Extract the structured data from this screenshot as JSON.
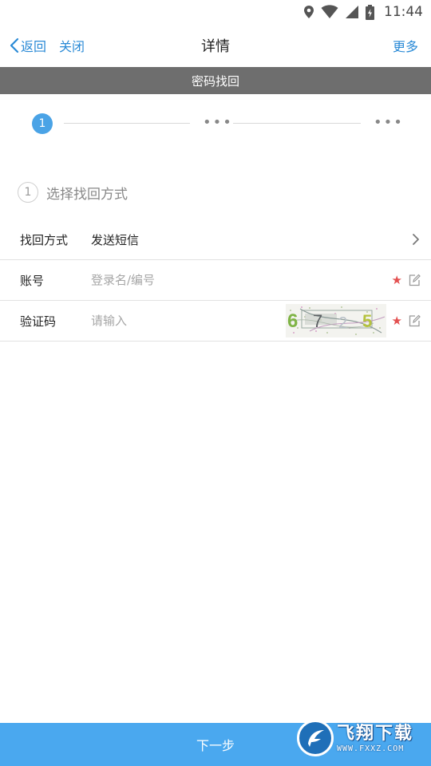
{
  "status_bar": {
    "time": "11:44",
    "icons": [
      "location-icon",
      "wifi-icon",
      "signal-icon",
      "battery-icon"
    ]
  },
  "navbar": {
    "back_label": "返回",
    "close_label": "关闭",
    "title": "详情",
    "more_label": "更多"
  },
  "section_title": "密码找回",
  "stepper": {
    "current_step": "1",
    "pending_dots": "•••"
  },
  "step_heading": {
    "number": "1",
    "text": "选择找回方式"
  },
  "form": {
    "method": {
      "label": "找回方式",
      "value": "发送短信"
    },
    "account": {
      "label": "账号",
      "placeholder": "登录名/编号",
      "required_mark": "★"
    },
    "captcha": {
      "label": "验证码",
      "placeholder": "请输入",
      "required_mark": "★",
      "code": [
        "6",
        "7",
        "2",
        "5"
      ]
    }
  },
  "bottom_button": {
    "label": "下一步"
  },
  "watermark": {
    "cn": "飞翔下载",
    "en": "WWW.FXXZ.COM"
  },
  "colors": {
    "accent": "#2a8ad6",
    "step_active": "#4aa3e6",
    "section_bar": "#6e6e6e",
    "button": "#4aa8ef",
    "required": "#e35050"
  }
}
